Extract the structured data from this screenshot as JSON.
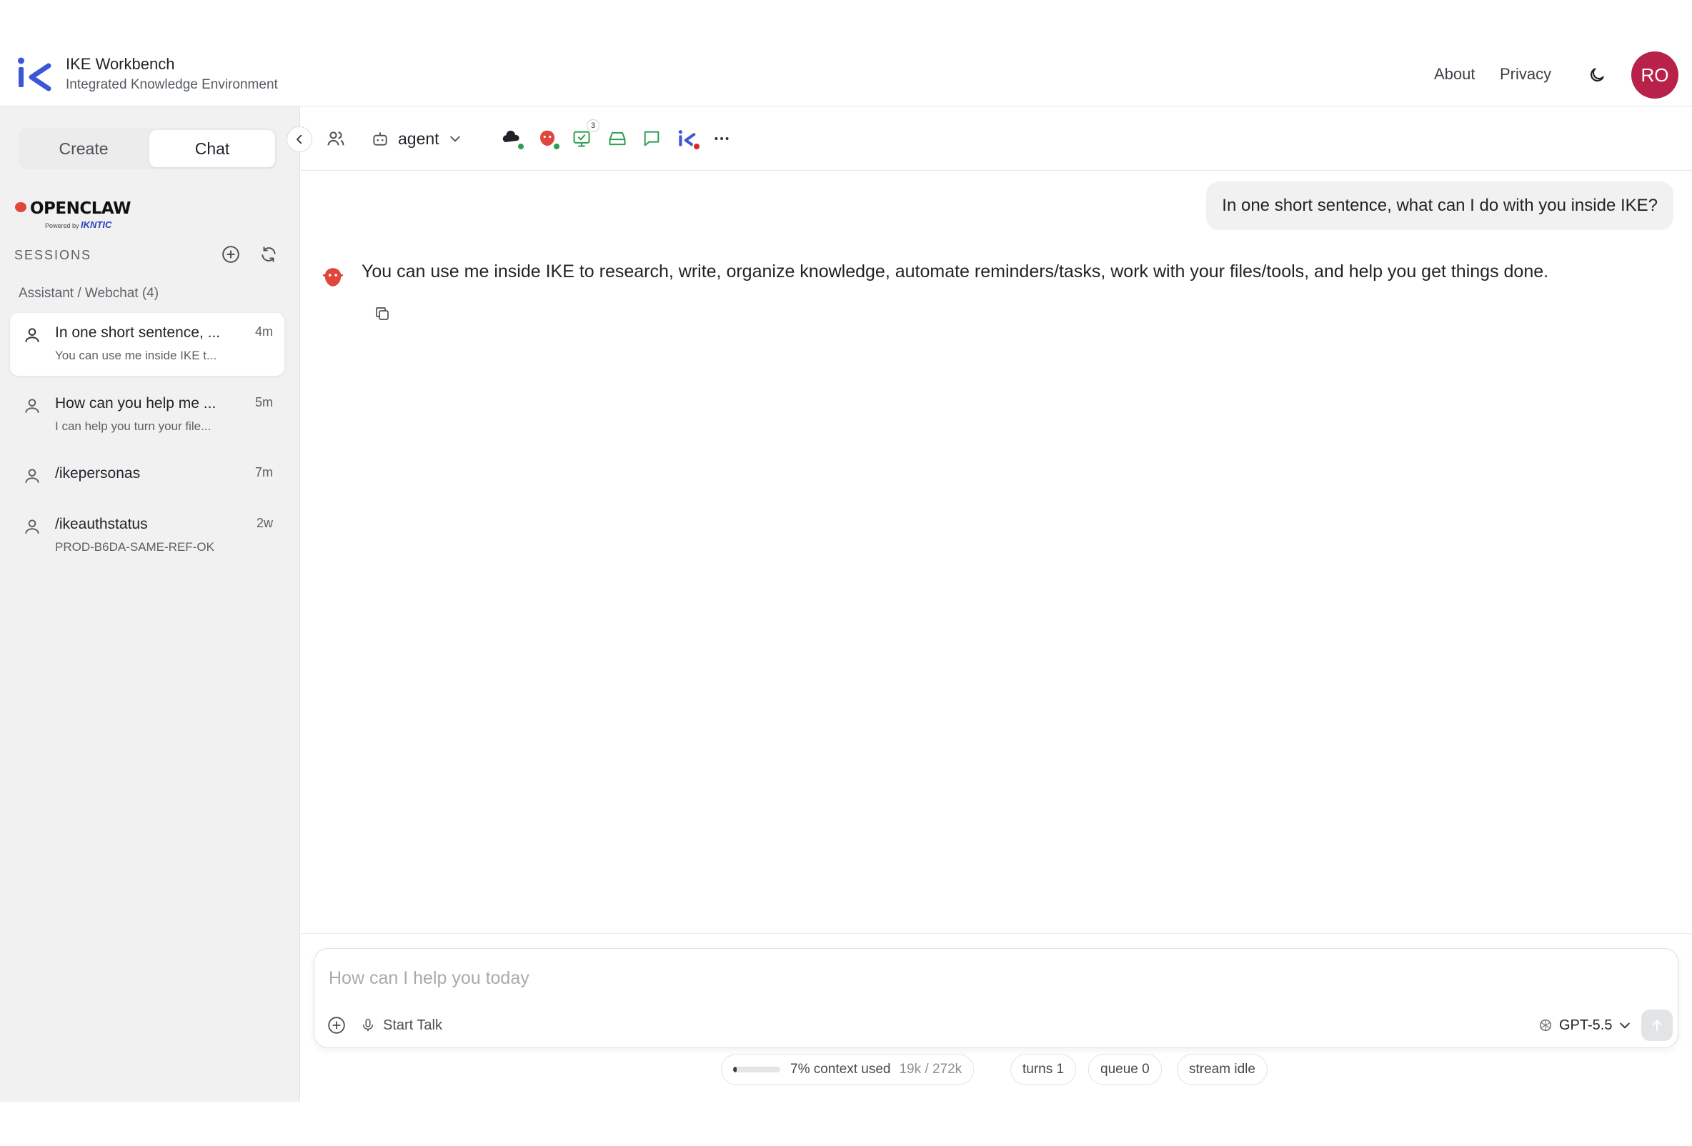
{
  "app": {
    "title": "IKE Workbench",
    "subtitle": "Integrated Knowledge Environment",
    "nav": {
      "about": "About",
      "privacy": "Privacy"
    },
    "avatar_initials": "RO",
    "avatar_color": "#b8224a"
  },
  "sidebar": {
    "tabs": {
      "create": "Create",
      "chat": "Chat"
    },
    "brand": {
      "name": "OPENCLAW",
      "powered_by": "Powered by",
      "powered_brand": "IKNTIC"
    },
    "sessions_label": "SESSIONS",
    "group_label": "Assistant / Webchat (4)",
    "sessions": [
      {
        "title": "In one short sentence, ...",
        "preview": "You can use me inside IKE t...",
        "time": "4m",
        "active": true
      },
      {
        "title": "How can you help me ...",
        "preview": "I can help you turn your file...",
        "time": "5m",
        "active": false
      },
      {
        "title": "/ikepersonas",
        "preview": "",
        "time": "7m",
        "active": false
      },
      {
        "title": "/ikeauthstatus",
        "preview": "PROD-B6DA-SAME-REF-OK",
        "time": "2w",
        "active": false
      }
    ]
  },
  "toolbar": {
    "agent_label": "agent",
    "monitor_badge": "3",
    "icons": [
      "users-icon",
      "bot-icon",
      "cloud-icon",
      "openclaw-icon",
      "monitor-check-icon",
      "inbox-icon",
      "message-icon",
      "ike-logo-icon",
      "more-icon"
    ]
  },
  "chat": {
    "user_message": "In one short sentence, what can I do with you inside IKE?",
    "bot_message": "You can use me inside IKE to research, write, organize knowledge, automate reminders/tasks, work with your files/tools, and help you get things done."
  },
  "composer": {
    "placeholder": "How can I help you today",
    "start_talk": "Start Talk",
    "model": "GPT-5.5"
  },
  "status": {
    "context_fraction": 0.07,
    "context_label": "7% context used",
    "context_tokens": "19k / 272k",
    "turns": "turns 1",
    "queue": "queue 0",
    "stream": "stream idle"
  },
  "colors": {
    "accent_blue": "#3b56d9",
    "openclaw_red": "#e0463b",
    "status_green": "#2e9e4f",
    "status_red": "#d6262b"
  }
}
